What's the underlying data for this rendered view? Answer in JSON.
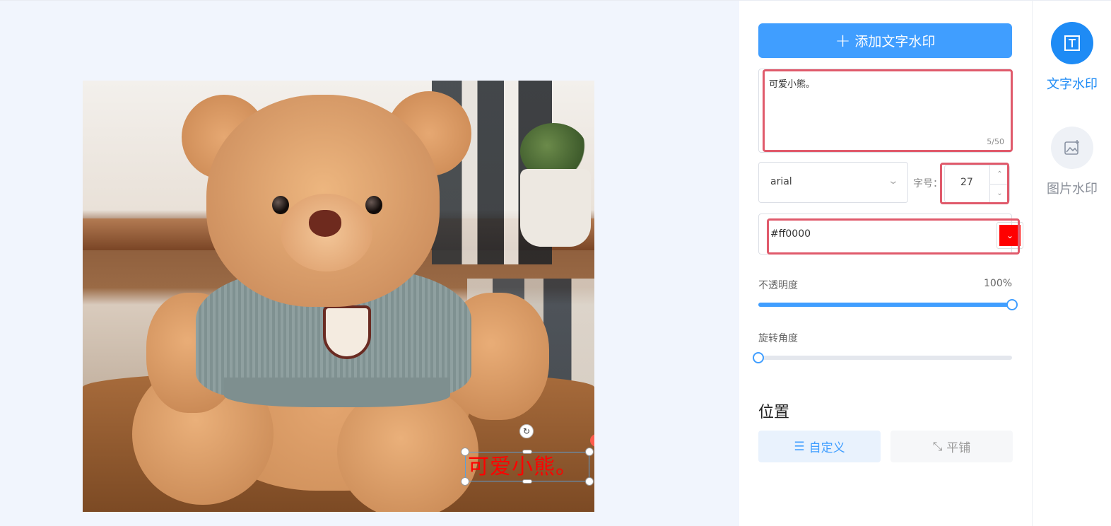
{
  "canvas": {
    "watermark_text": "可爱小熊。",
    "rotate_icon": "rotate-icon",
    "watermark_color": "#ff0000"
  },
  "panel": {
    "add_button": {
      "icon": "plus-icon",
      "label": "添加文字水印"
    },
    "text_input": {
      "value": "可爱小熊。",
      "counter": "5/50"
    },
    "font_select": {
      "value": "arial",
      "icon": "chevron-down-icon"
    },
    "font_size": {
      "label": "字号：",
      "value": "27"
    },
    "color": {
      "value": "#ff0000",
      "swatch": "#ff0000"
    },
    "opacity": {
      "label": "不透明度",
      "value_text": "100%",
      "value": 1.0
    },
    "rotation": {
      "label": "旋转角度",
      "value": 0
    },
    "position": {
      "title": "位置",
      "custom_label": "自定义",
      "tile_label": "平铺"
    }
  },
  "side_nav": {
    "items": [
      {
        "label": "文字水印",
        "icon": "text-watermark-icon",
        "active": true
      },
      {
        "label": "图片水印",
        "icon": "image-watermark-icon",
        "active": false
      }
    ]
  },
  "colors": {
    "accent": "#409eff",
    "highlight": "#e05a6b"
  }
}
